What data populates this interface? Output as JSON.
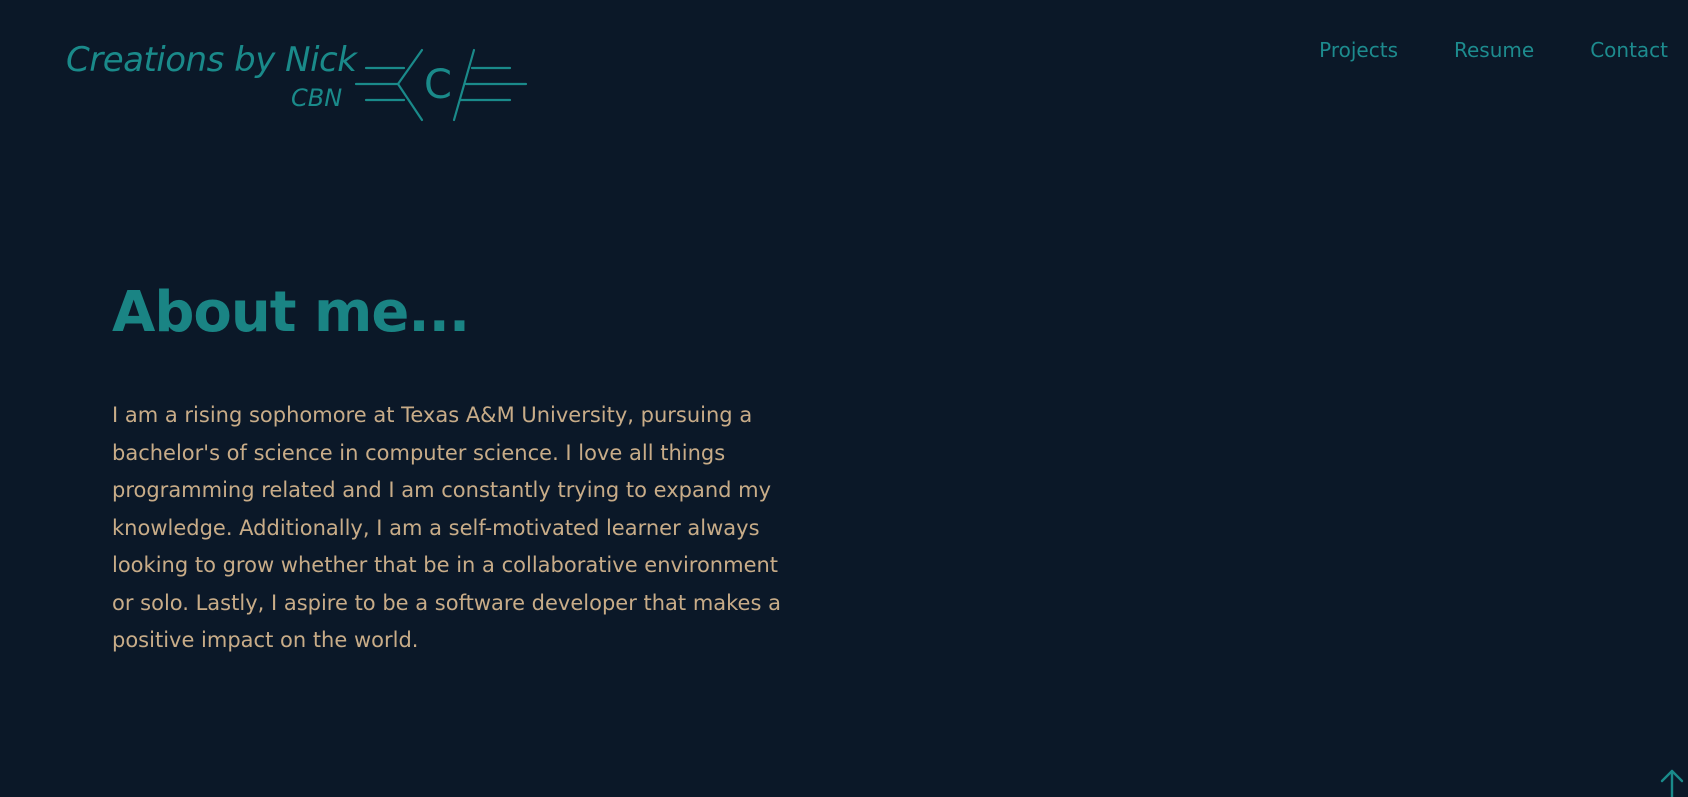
{
  "colors": {
    "background": "#0b1828",
    "accent": "#1a8a8a",
    "body_text": "#c8ac88"
  },
  "logo": {
    "title": "Creations by Nick",
    "subtitle": "CBN",
    "mark_letter": "C"
  },
  "nav": {
    "items": [
      {
        "label": "Projects"
      },
      {
        "label": "Resume"
      },
      {
        "label": "Contact"
      }
    ]
  },
  "about": {
    "heading": "About me...",
    "body": "I am a rising sophomore at Texas A&M University, pursuing a bachelor's of science in computer science. I love all things programming related and I am constantly trying to expand my knowledge. Additionally, I am a self-motivated learner always looking to grow whether that be in a collaborative environment or solo. Lastly, I aspire to be a software developer that makes a positive impact on the world."
  },
  "back_to_top": {
    "icon": "arrow-up-icon"
  }
}
